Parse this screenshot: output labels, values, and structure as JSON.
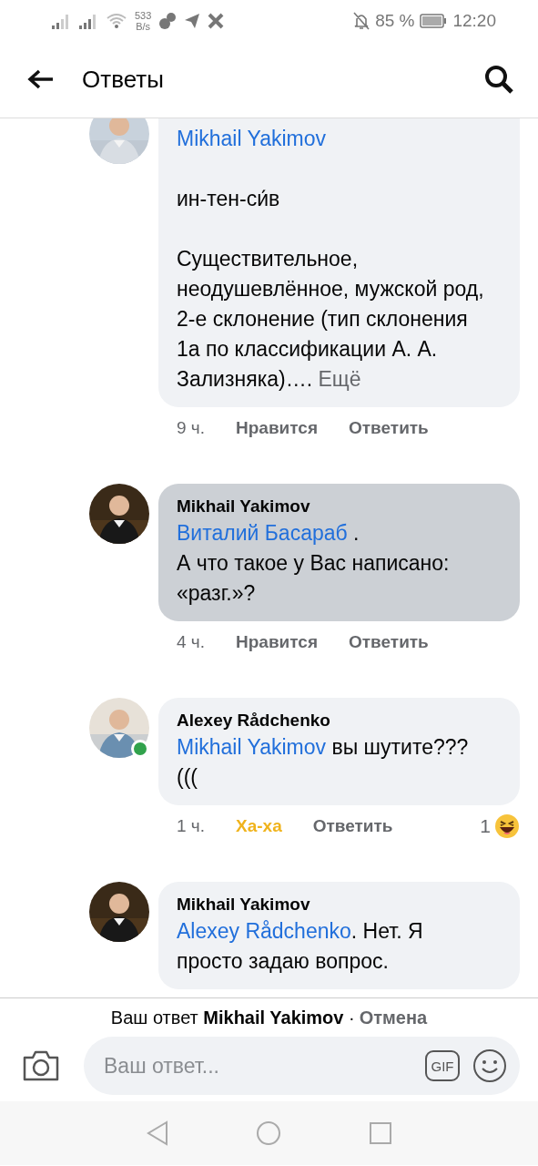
{
  "status_bar": {
    "speed_value": "533",
    "speed_unit": "B/s",
    "battery": "85 %",
    "time": "12:20"
  },
  "header": {
    "title": "Ответы"
  },
  "comments": [
    {
      "mention": "Mikhail Yakimov",
      "text": "\n\nин-тен-си́в\n\nСуществительное, неодушевлённое, мужской род, 2-е склонение (тип склонения 1а по классификации А. А. Зализняка)….",
      "more": "Ещё",
      "selected": false,
      "online": false,
      "time": "9 ч.",
      "reaction_label": "Нравится",
      "reacted": false,
      "reply_label": "Ответить"
    },
    {
      "author": "Mikhail Yakimov",
      "mention": "Виталий Басараб",
      "text": " .\nА что такое у Вас написано: «разг.»?",
      "selected": true,
      "online": false,
      "time": "4 ч.",
      "reaction_label": "Нравится",
      "reacted": false,
      "reply_label": "Ответить"
    },
    {
      "author": "Alexey Rådchenko",
      "mention": "Mikhail Yakimov",
      "text": " вы шутите???(((",
      "selected": false,
      "online": true,
      "time": "1 ч.",
      "reaction_label": "Ха-ха",
      "reacted": true,
      "reply_label": "Ответить",
      "reaction_count": "1"
    },
    {
      "author": "Mikhail Yakimov",
      "mention": "Alexey Rådchenko",
      "text": ". Нет. Я просто задаю вопрос.",
      "selected": false,
      "online": false
    }
  ],
  "reply_bar": {
    "notice": "Ваш ответ **Mikhail Yakimov** ·",
    "cancel": "Отмена",
    "placeholder": "Ваш ответ...",
    "gif": "GIF"
  }
}
